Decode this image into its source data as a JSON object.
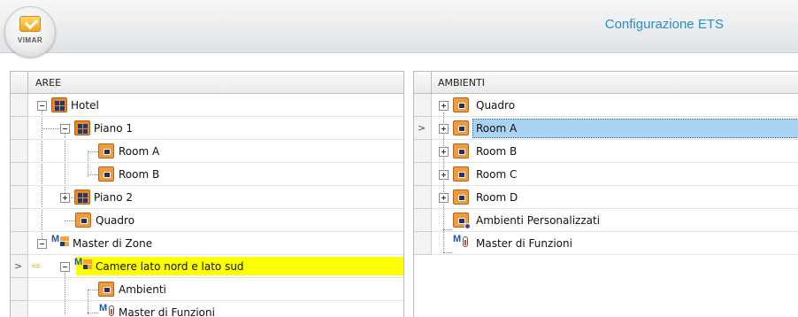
{
  "app": {
    "brand": "VIMAR",
    "title": "Configurazione ETS"
  },
  "left_panel": {
    "header": "AREE",
    "rows": [
      {
        "label": "Hotel"
      },
      {
        "label": "Piano 1"
      },
      {
        "label": "Room A"
      },
      {
        "label": "Room B"
      },
      {
        "label": "Piano 2"
      },
      {
        "label": "Quadro"
      },
      {
        "label": "Master di Zone"
      },
      {
        "label": "Camere lato nord e lato sud",
        "current": true
      },
      {
        "label": "Ambienti"
      },
      {
        "label": "Master di Funzioni"
      }
    ]
  },
  "right_panel": {
    "header": "AMBIENTI",
    "rows": [
      {
        "label": "Quadro"
      },
      {
        "label": "Room A",
        "selected": true
      },
      {
        "label": "Room B"
      },
      {
        "label": "Room C"
      },
      {
        "label": "Room D"
      },
      {
        "label": "Ambienti Personalizzati"
      },
      {
        "label": "Master di Funzioni"
      }
    ]
  },
  "colors": {
    "title": "#2f8cc4",
    "highlight_row": "#ffff00",
    "selected_row": "#a9d3f2"
  }
}
